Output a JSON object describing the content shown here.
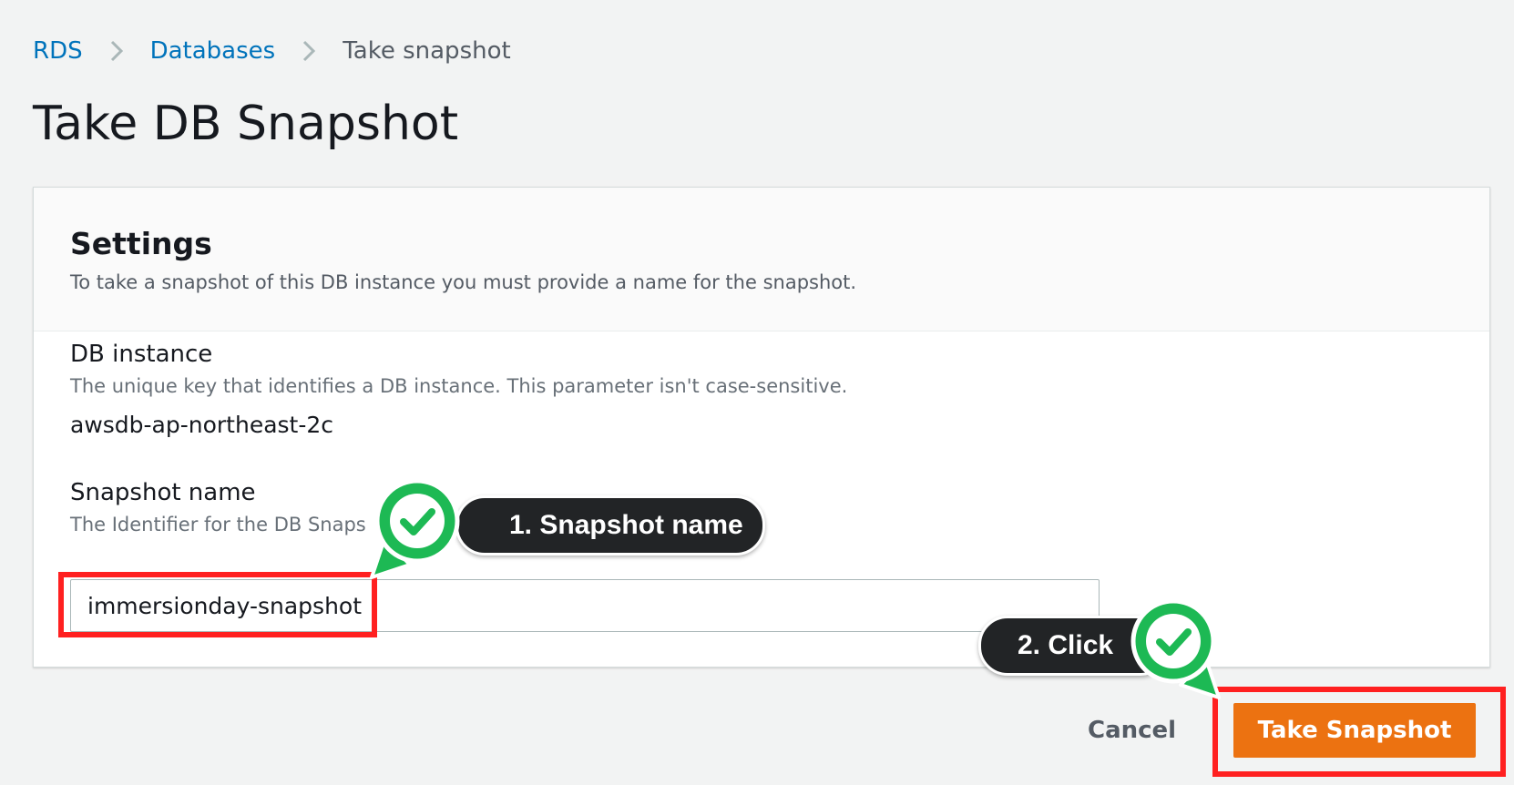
{
  "breadcrumb": {
    "items": [
      {
        "label": "RDS"
      },
      {
        "label": "Databases"
      },
      {
        "label": "Take snapshot"
      }
    ]
  },
  "page": {
    "title": "Take DB Snapshot"
  },
  "settings": {
    "title": "Settings",
    "description": "To take a snapshot of this DB instance you must provide a name for the snapshot."
  },
  "db_instance": {
    "label": "DB instance",
    "description": "The unique key that identifies a DB instance. This parameter isn't case-sensitive.",
    "value": "awsdb-ap-northeast-2c"
  },
  "snapshot_name": {
    "label": "Snapshot name",
    "description": "The Identifier for the DB Snaps",
    "value": "immersionday-snapshot"
  },
  "actions": {
    "cancel_label": "Cancel",
    "submit_label": "Take Snapshot"
  },
  "annotations": {
    "step1": "1. Snapshot name",
    "step2": "2. Click"
  },
  "colors": {
    "link": "#0073bb",
    "primary": "#ec7211",
    "highlight": "#ff2020",
    "check_green": "#1db954",
    "pill_dark": "#222426"
  },
  "icons": {
    "breadcrumb_separator": "chevron-right-icon",
    "annotation_marker": "check-pin-icon"
  }
}
